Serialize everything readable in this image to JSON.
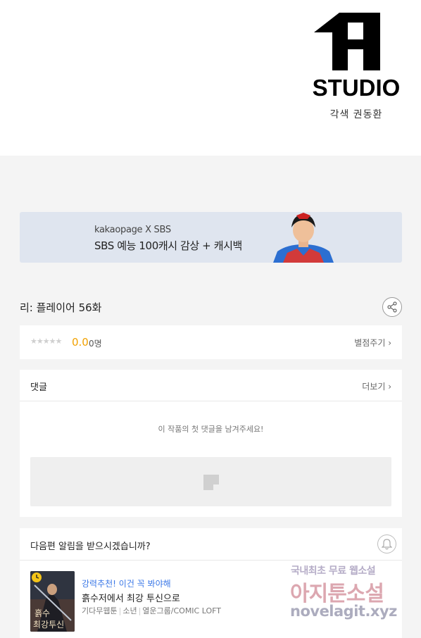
{
  "header": {
    "logo_text": "STUDIO",
    "credit": "각색 권동환"
  },
  "banner": {
    "line1": "kakaopage X SBS",
    "line2": "SBS 예능 100캐시 감상 + 캐시백"
  },
  "episode": {
    "title": "리: 플레이어 56화",
    "share_icon": "share-icon"
  },
  "rating": {
    "stars": "★★★★★",
    "score": "0.0",
    "count": "0명",
    "rate_link": "별점주기 ›"
  },
  "comments": {
    "title": "댓글",
    "more_link": "더보기 ›",
    "empty_message": "이 작품의 첫 댓글을 남겨주세요!"
  },
  "notification": {
    "question": "다음편 알림을 받으시겠습니까?",
    "recommend": {
      "headline": "강력추천! 이건 꼭 봐야해",
      "title": "흙수저에서 최강 투신으로",
      "meta": [
        "기다무웹툰",
        "소년",
        "열운그룹/COMIC LOFT"
      ]
    }
  },
  "watermark": {
    "line1": "국내최초 무료 웹소설",
    "line2": "아지툰소설",
    "line3": "novelagit.xyz"
  },
  "colors": {
    "score": "#f2a100",
    "headline": "#3b78e7",
    "page_bg": "#f4f4f4",
    "banner_bg": "#dfe5ef"
  }
}
